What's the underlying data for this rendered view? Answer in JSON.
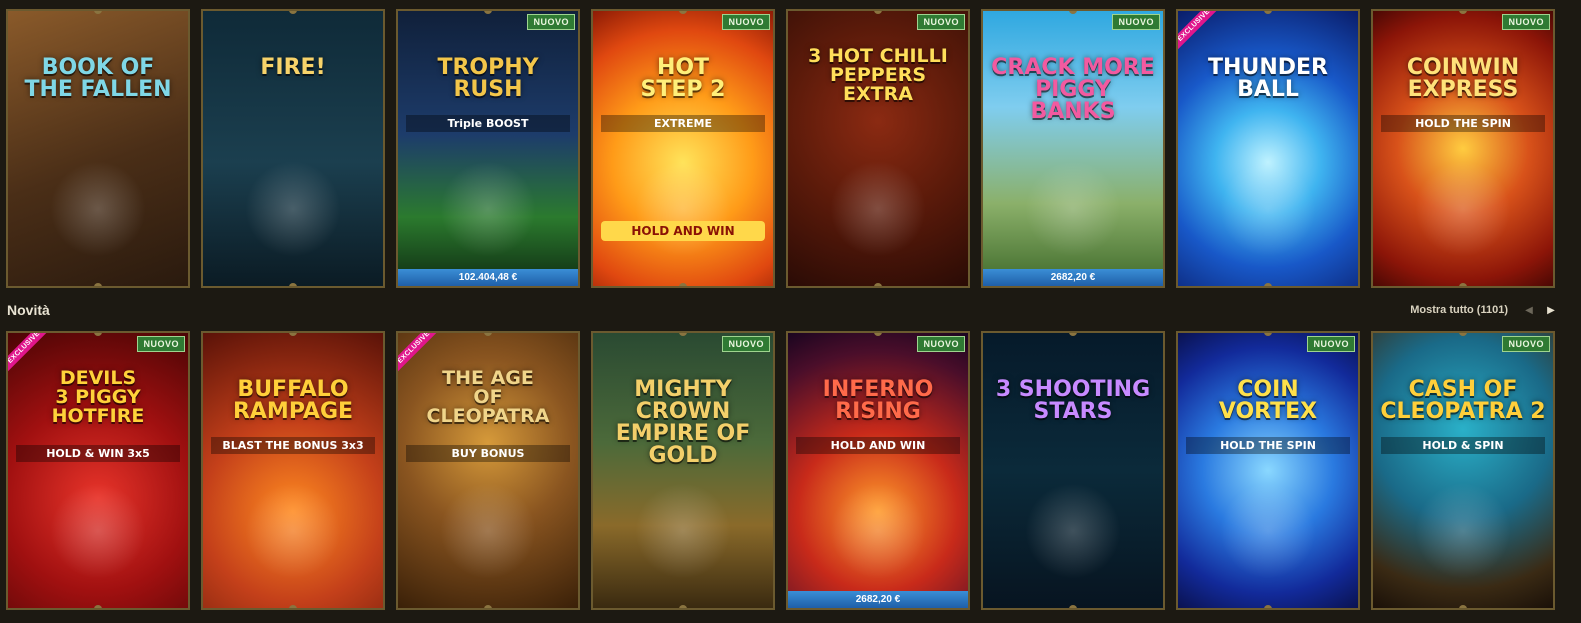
{
  "row_top": [
    {
      "title": "BOOK OF\nTHE FALLEN",
      "subtitle": "",
      "badge": "",
      "ribbon": "",
      "jackpot": "",
      "bg": "linear-gradient(160deg,#8a5a2a 0%,#4a2e17 55%,#2a1a0e 100%)",
      "title_color": "#7fd7e6"
    },
    {
      "title": "FIRE!",
      "subtitle": "",
      "badge": "",
      "ribbon": "",
      "jackpot": "",
      "bg": "linear-gradient(180deg,#0f2a38 0%,#1b3f4f 55%,#0b1b24 100%)",
      "title_color": "#f7d36a"
    },
    {
      "title": "TROPHY\nRUSH",
      "subtitle": "Triple BOOST",
      "badge": "NUOVO",
      "ribbon": "",
      "jackpot": "102.404,48 €",
      "bg": "linear-gradient(180deg,#10203a 0%,#1d3c6b 45%,#2b7a2e 75%,#0f2c12 100%)",
      "title_color": "#f3c64a"
    },
    {
      "title": "HOT\nSTEP 2",
      "subtitle": "EXTREME",
      "badge": "NUOVO",
      "ribbon": "",
      "jackpot": "",
      "bg": "radial-gradient(circle at 50% 55%,#ffe35a 0%,#ff9b18 40%,#e04810 75%,#8d1b05 100%)",
      "title_color": "#ffef7a",
      "extra": "HOLD AND WIN"
    },
    {
      "title": "3 HOT CHILLI\nPEPPERS\nEXTRA",
      "subtitle": "",
      "badge": "NUOVO",
      "ribbon": "",
      "jackpot": "",
      "bg": "radial-gradient(circle at 50% 40%,#8b2a12 0%,#5a1a0a 50%,#2a0b05 100%)",
      "title_color": "#ffdf5a"
    },
    {
      "title": "CRACK MORE\nPIGGY BANKS",
      "subtitle": "",
      "badge": "NUOVO",
      "ribbon": "",
      "jackpot": "2682,20 €",
      "bg": "linear-gradient(180deg,#2fa8e0 0%,#7fcdef 35%,#8bb06a 70%,#3f6a2a 100%)",
      "title_color": "#f25aa0"
    },
    {
      "title": "THUNDER\nBALL",
      "subtitle": "",
      "badge": "",
      "ribbon": "EXCLUSIVE",
      "jackpot": "",
      "bg": "radial-gradient(circle at 50% 55%,#bff2ff 0%,#3fb4f0 30%,#1858c8 60%,#0a1d6a 100%)",
      "title_color": "#ffffff"
    },
    {
      "title": "COINWIN\nEXPRESS",
      "subtitle": "HOLD THE SPIN",
      "badge": "NUOVO",
      "ribbon": "",
      "jackpot": "",
      "bg": "radial-gradient(circle at 50% 50%,#ffcc40 0%,#d8521a 40%,#8c1508 80%,#4a0804 100%)",
      "title_color": "#ffe27a"
    }
  ],
  "section": {
    "label": "Novità",
    "show_all": "Mostra tutto (1101)",
    "prev_icon": "◀",
    "next_icon": "▶"
  },
  "row_bottom": [
    {
      "title": "DEVILS\n3 PIGGY\nHOTFIRE",
      "subtitle": "HOLD & WIN 3x5",
      "badge": "NUOVO",
      "ribbon": "EXCLUSIVE",
      "jackpot": "",
      "bg": "radial-gradient(circle at 50% 60%,#e8342a 0%,#a01010 50%,#4a0505 100%)",
      "title_color": "#ffd23a"
    },
    {
      "title": "BUFFALO\nRAMPAGE",
      "subtitle": "BLAST THE BONUS 3x3",
      "badge": "",
      "ribbon": "",
      "jackpot": "",
      "bg": "radial-gradient(circle at 50% 65%,#ff8a20 0%,#c4401a 45%,#5a1208 100%)",
      "title_color": "#ffcf3a"
    },
    {
      "title": "THE AGE\nOF\nCLEOPATRA",
      "subtitle": "BUY BONUS",
      "badge": "",
      "ribbon": "EXCLUSIVE",
      "jackpot": "",
      "bg": "radial-gradient(circle at 50% 40%,#d69a3a 0%,#8a5520 45%,#3a2008 100%)",
      "title_color": "#f0d58a"
    },
    {
      "title": "MIGHTY CROWN\nEMPIRE OF GOLD",
      "subtitle": "",
      "badge": "NUOVO",
      "ribbon": "",
      "jackpot": "",
      "bg": "linear-gradient(180deg,#2a4a32 0%,#4c6a3a 40%,#8a6a2a 70%,#3a2a10 100%)",
      "title_color": "#f3cf6a"
    },
    {
      "title": "INFERNO\nRISING",
      "subtitle": "HOLD AND WIN",
      "badge": "NUOVO",
      "ribbon": "",
      "jackpot": "2682,20 €",
      "bg": "radial-gradient(circle at 50% 65%,#ff9a2a 0%,#c82a1a 40%,#4a0e2a 80%,#1a0520 100%)",
      "title_color": "#ff6a4a"
    },
    {
      "title": "3 SHOOTING\nSTARS",
      "subtitle": "",
      "badge": "",
      "ribbon": "",
      "jackpot": "",
      "bg": "linear-gradient(180deg,#061a2a 0%,#0b2a3a 50%,#071420 100%)",
      "title_color": "#c78aff"
    },
    {
      "title": "COIN\nVORTEX",
      "subtitle": "HOLD THE SPIN",
      "badge": "NUOVO",
      "ribbon": "",
      "jackpot": "",
      "bg": "radial-gradient(circle at 50% 50%,#8ad8ff 0%,#2a7ae0 40%,#122a9a 75%,#0a1250 100%)",
      "title_color": "#ffe04a"
    },
    {
      "title": "CASH OF\nCLEOPATRA 2",
      "subtitle": "HOLD & SPIN",
      "badge": "NUOVO",
      "ribbon": "",
      "jackpot": "",
      "bg": "radial-gradient(circle at 50% 35%,#2ab0c8 0%,#1a6a88 45%,#3a2a14 80%,#1a1008 100%)",
      "title_color": "#ffcf3a"
    }
  ]
}
